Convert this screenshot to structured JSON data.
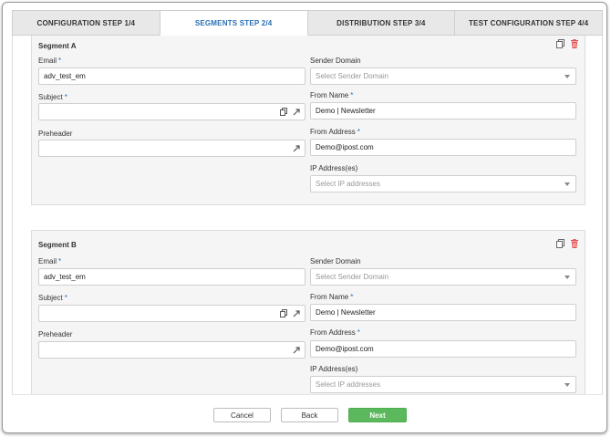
{
  "tabs": [
    {
      "label": "CONFIGURATION STEP 1/4"
    },
    {
      "label": "SEGMENTS STEP 2/4"
    },
    {
      "label": "DISTRIBUTION STEP 3/4"
    },
    {
      "label": "TEST CONFIGURATION STEP 4/4"
    }
  ],
  "active_tab": "SEGMENTS STEP 2/4",
  "required_mark": "*",
  "segments": [
    {
      "title": "Segment A",
      "email_label": "Email",
      "email_value": "adv_test_em",
      "subject_label": "Subject",
      "subject_value": "",
      "preheader_label": "Preheader",
      "preheader_value": "",
      "sender_domain_label": "Sender Domain",
      "sender_domain_placeholder": "Select Sender Domain",
      "from_name_label": "From Name",
      "from_name_value": "Demo | Newsletter",
      "from_address_label": "From Address",
      "from_address_value": "Demo@ipost.com",
      "ip_label": "IP Address(es)",
      "ip_placeholder": "Select IP addresses"
    },
    {
      "title": "Segment B",
      "email_label": "Email",
      "email_value": "adv_test_em",
      "subject_label": "Subject",
      "subject_value": "",
      "preheader_label": "Preheader",
      "preheader_value": "",
      "sender_domain_label": "Sender Domain",
      "sender_domain_placeholder": "Select Sender Domain",
      "from_name_label": "From Name",
      "from_name_value": "Demo | Newsletter",
      "from_address_label": "From Address",
      "from_address_value": "Demo@ipost.com",
      "ip_label": "IP Address(es)",
      "ip_placeholder": "Select IP addresses"
    }
  ],
  "footer": {
    "cancel_label": "Cancel",
    "back_label": "Back",
    "next_label": "Next"
  },
  "colors": {
    "accent": "#2a6fb3",
    "next_button": "#5cb85c",
    "delete_icon": "#e05050"
  },
  "icons": {
    "copy": "copy-icon",
    "delete": "trash-icon",
    "expand": "expand-arrow-icon",
    "dropdown": "chevron-down-icon"
  }
}
